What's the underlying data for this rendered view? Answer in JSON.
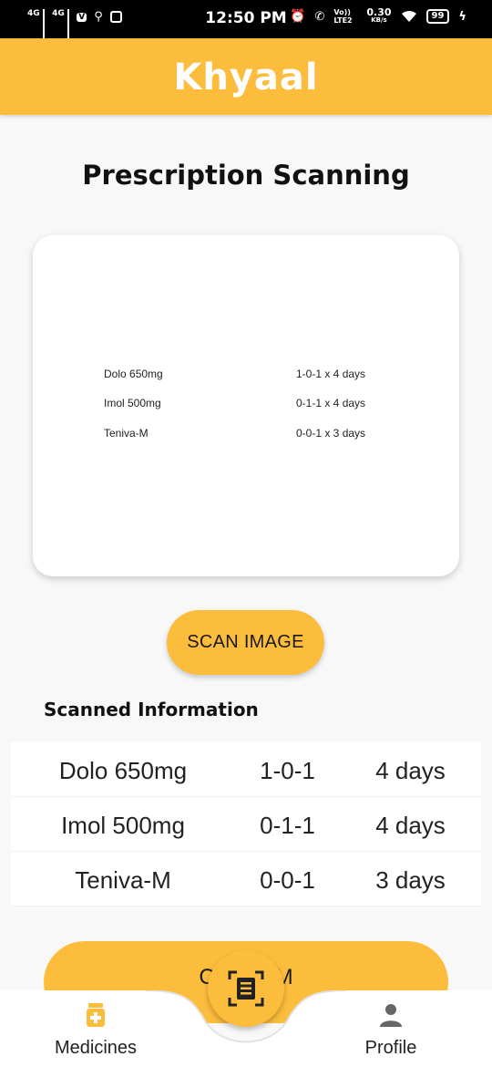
{
  "status_bar": {
    "left_labels": [
      "4G",
      "4G"
    ],
    "time": "12:50 PM",
    "volte": "Vo)) LTE2",
    "speed_value": "0.30",
    "speed_unit": "KB/s",
    "battery": "99"
  },
  "app": {
    "title": "Khyaal"
  },
  "page": {
    "title": "Prescription Scanning"
  },
  "scanned_image": {
    "rows": [
      {
        "name": "Dolo 650mg",
        "dose": "1-0-1 x 4 days"
      },
      {
        "name": "Imol 500mg",
        "dose": "0-1-1 x 4 days"
      },
      {
        "name": "Teniva-M",
        "dose": "0-0-1 x 3 days"
      }
    ]
  },
  "scan_button": {
    "label": "SCAN IMAGE"
  },
  "scanned_info": {
    "title": "Scanned Information",
    "rows": [
      {
        "name": "Dolo 650mg",
        "dosage": "1-0-1",
        "duration": "4 days"
      },
      {
        "name": "Imol 500mg",
        "dosage": "0-1-1",
        "duration": "4 days"
      },
      {
        "name": "Teniva-M",
        "dosage": "0-0-1",
        "duration": "3 days"
      }
    ]
  },
  "confirm_button": {
    "label_left": "C",
    "label_right": "M"
  },
  "bottom_nav": {
    "items": [
      {
        "label": "Medicines",
        "icon": "medicine-bottle-icon"
      },
      {
        "label": "Profile",
        "icon": "person-icon"
      }
    ],
    "center_icon": "document-scan-icon"
  },
  "colors": {
    "accent": "#fcbd3d",
    "background": "#f8f8f8",
    "status_bar": "#000000"
  }
}
